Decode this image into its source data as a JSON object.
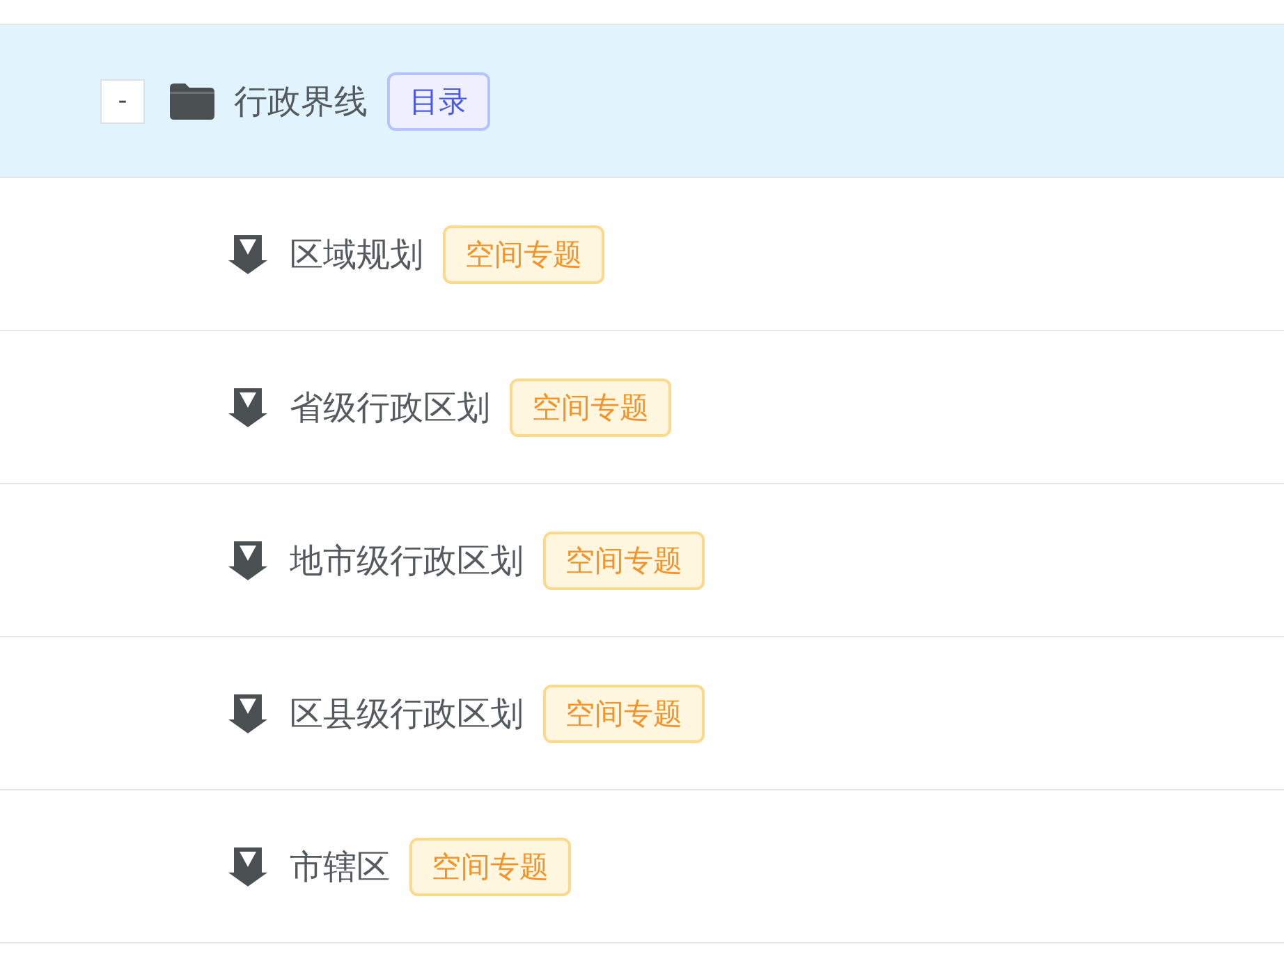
{
  "tree": [
    {
      "label": "行政界线",
      "kind": "folder",
      "toggle": "-",
      "expanded": true,
      "selected": true,
      "tag": {
        "text": "目录",
        "kind": "directory"
      },
      "children": [
        {
          "label": "区域规划",
          "kind": "layer",
          "selected": false,
          "tag": {
            "text": "空间专题",
            "kind": "thematic"
          }
        },
        {
          "label": "省级行政区划",
          "kind": "layer",
          "selected": false,
          "tag": {
            "text": "空间专题",
            "kind": "thematic"
          }
        },
        {
          "label": "地市级行政区划",
          "kind": "layer",
          "selected": false,
          "tag": {
            "text": "空间专题",
            "kind": "thematic"
          }
        },
        {
          "label": "区县级行政区划",
          "kind": "layer",
          "selected": false,
          "tag": {
            "text": "空间专题",
            "kind": "thematic"
          }
        },
        {
          "label": "市辖区",
          "kind": "layer",
          "selected": false,
          "tag": {
            "text": "空间专题",
            "kind": "thematic"
          }
        }
      ]
    }
  ]
}
